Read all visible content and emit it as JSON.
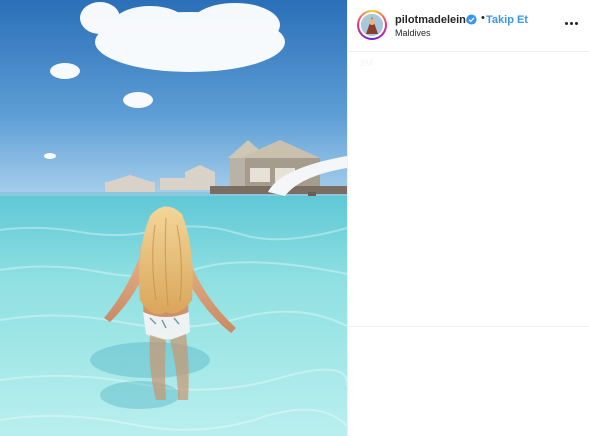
{
  "post": {
    "username": "pilotmadeleine",
    "verified": true,
    "separator": "•",
    "follow_label": "Takip Et",
    "location": "Maldives",
    "faint_text": "2M"
  },
  "icons": {
    "verified": "verified-badge-icon",
    "more": "more-options-icon"
  },
  "colors": {
    "follow": "#3897f0",
    "verified": "#3897f0",
    "text": "#262626",
    "border": "#efefef"
  }
}
